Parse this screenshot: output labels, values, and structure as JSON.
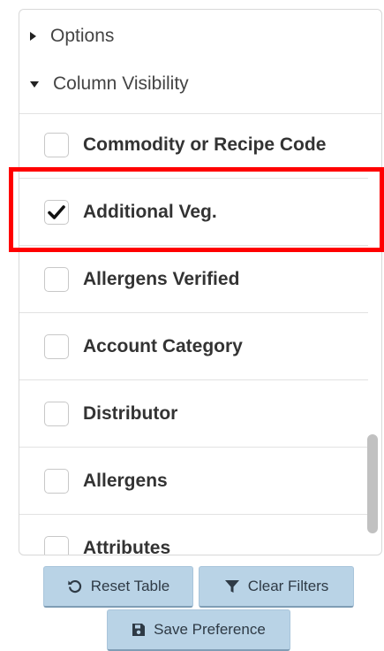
{
  "sections": {
    "options": {
      "label": "Options",
      "expanded": false
    },
    "column_visibility": {
      "label": "Column Visibility",
      "expanded": true
    }
  },
  "columns": [
    {
      "label": "Commodity or Recipe Code",
      "checked": false
    },
    {
      "label": "Additional Veg.",
      "checked": true
    },
    {
      "label": "Allergens Verified",
      "checked": false
    },
    {
      "label": "Account Category",
      "checked": false
    },
    {
      "label": "Distributor",
      "checked": false
    },
    {
      "label": "Allergens",
      "checked": false
    },
    {
      "label": "Attributes",
      "checked": false
    }
  ],
  "buttons": {
    "reset_table": "Reset Table",
    "clear_filters": "Clear Filters",
    "save_preference": "Save Preference"
  },
  "colors": {
    "highlight": "#ff0000",
    "button_bg": "#b9d3e6"
  },
  "icons": {
    "reset": "undo-icon",
    "filter": "filter-icon",
    "save": "floppy-disk-icon",
    "check": "check-icon"
  }
}
